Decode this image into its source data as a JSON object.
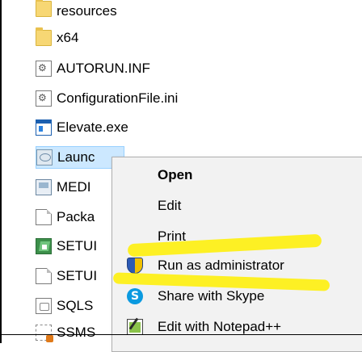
{
  "files": [
    {
      "name": "resources",
      "icon": "folder-icon"
    },
    {
      "name": "x64",
      "icon": "folder-icon"
    },
    {
      "name": "AUTORUN.INF",
      "icon": "config-file-icon"
    },
    {
      "name": "ConfigurationFile.ini",
      "icon": "config-file-icon"
    },
    {
      "name": "Elevate.exe",
      "icon": "exe-icon"
    },
    {
      "name": "Launc",
      "icon": "image-file-icon",
      "selected": true
    },
    {
      "name": "MEDI",
      "icon": "media-info-icon"
    },
    {
      "name": "Packa",
      "icon": "blank-file-icon"
    },
    {
      "name": "SETUI",
      "icon": "setup-icon"
    },
    {
      "name": "SETUI",
      "icon": "blank-file-icon"
    },
    {
      "name": "SQLS",
      "icon": "sql-setup-icon"
    },
    {
      "name": "SSMS",
      "icon": "ssms-icon"
    }
  ],
  "context_menu": {
    "items": [
      {
        "label": "Open",
        "bold": true
      },
      {
        "label": "Edit"
      },
      {
        "label": "Print"
      },
      {
        "label": "Run as administrator",
        "icon": "uac-shield-icon",
        "highlighted": true
      },
      {
        "label": "Share with Skype",
        "icon": "skype-icon"
      },
      {
        "label": "Edit with Notepad++",
        "icon": "notepadpp-icon"
      }
    ]
  },
  "colors": {
    "selection": "#cce8ff",
    "highlighter": "#fff000",
    "menu_bg": "#f2f2f2"
  }
}
